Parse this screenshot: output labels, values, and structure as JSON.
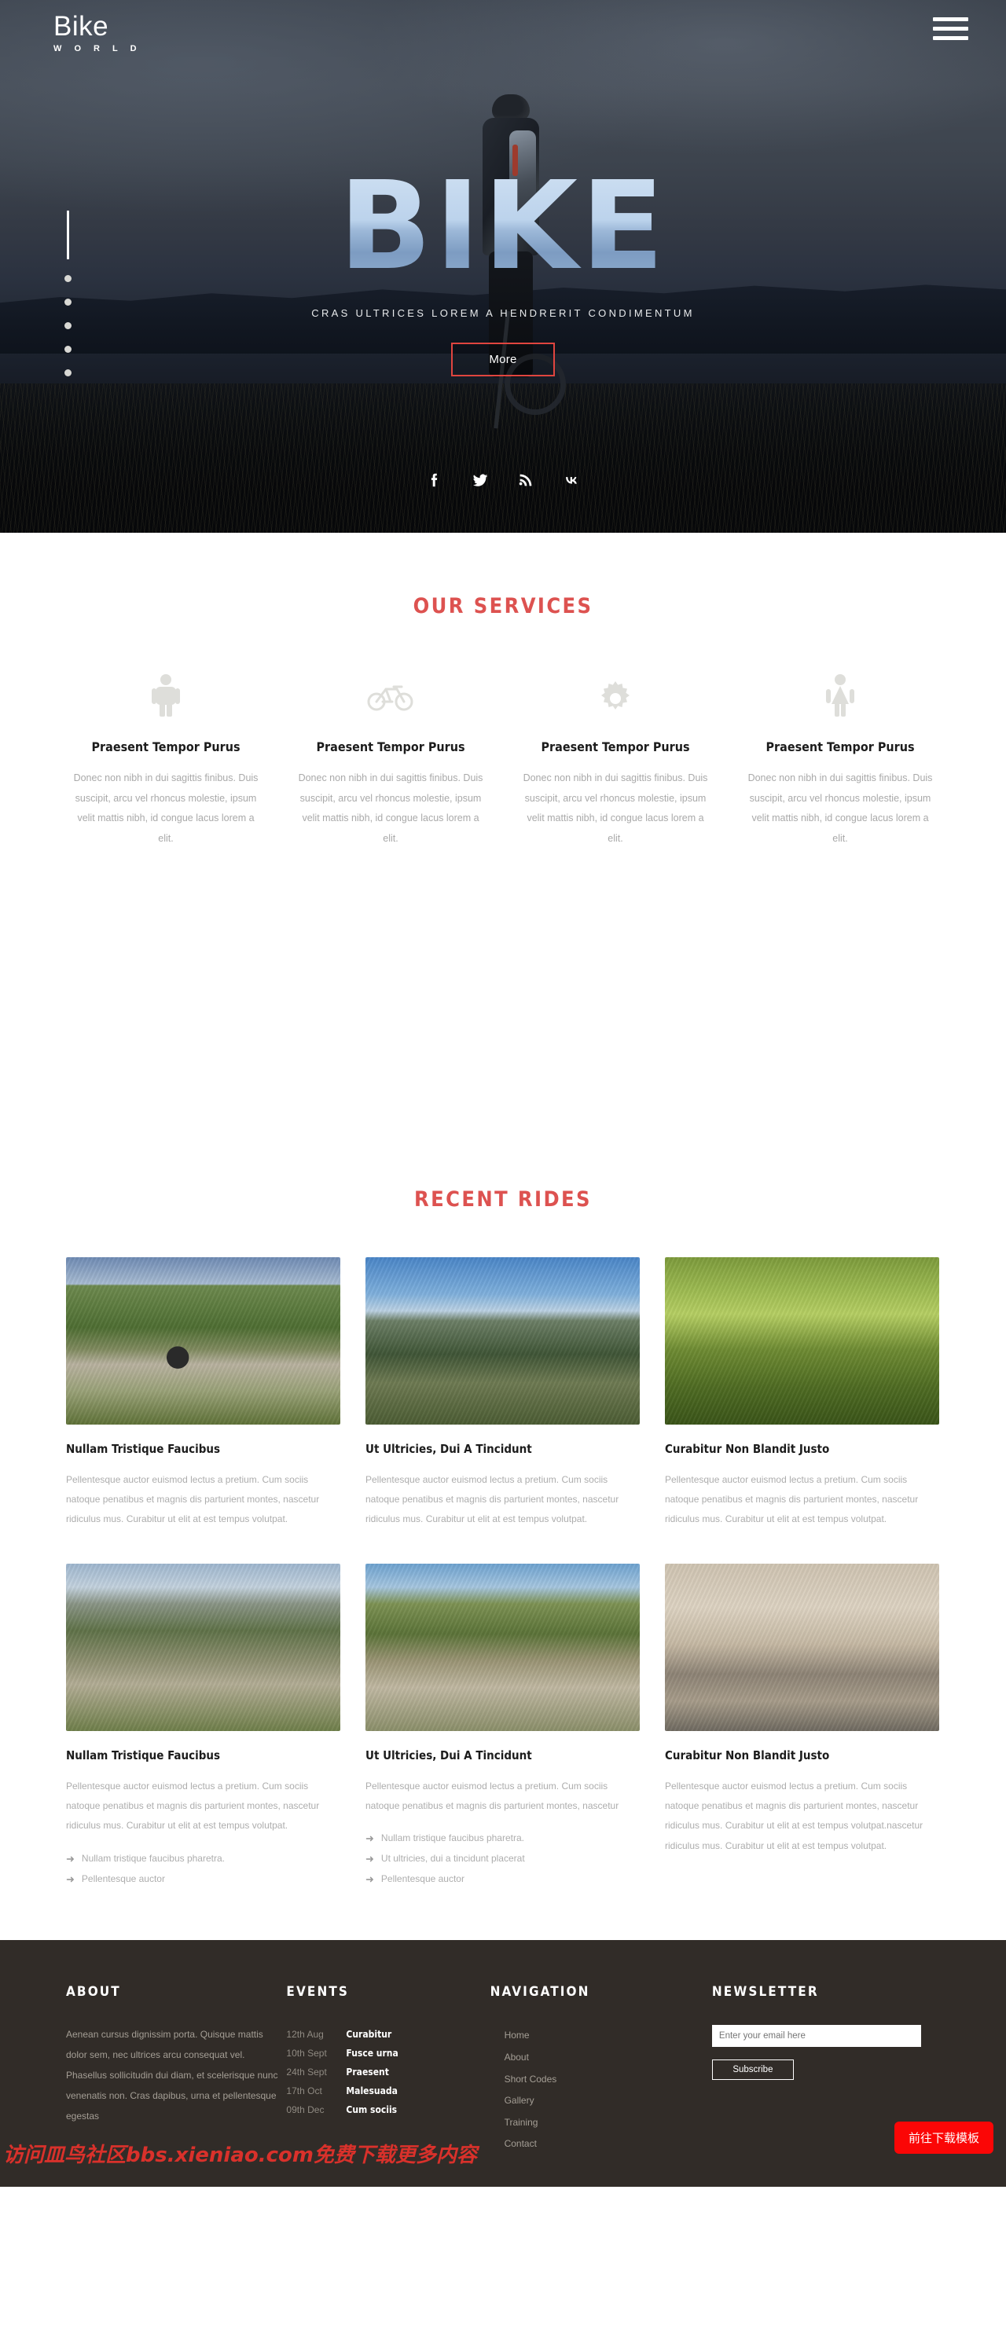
{
  "header": {
    "brand_name": "Bike",
    "brand_sub": "W O R L D",
    "menu_icon": "hamburger-menu-icon"
  },
  "hero": {
    "headline": "BIKE",
    "tagline": "CRAS ULTRICES LOREM A HENDRERIT CONDIMENTUM",
    "cta_label": "More",
    "cta_border_color": "#e0453f",
    "socials": [
      "facebook-icon",
      "twitter-icon",
      "rss-icon",
      "vk-icon"
    ],
    "dot_count": 5
  },
  "services": {
    "title": "OUR SERVICES",
    "title_color": "#dd5250",
    "items": [
      {
        "icon": "male-figure-icon",
        "title": "Praesent Tempor Purus",
        "text": "Donec non nibh in dui sagittis finibus. Duis suscipit, arcu vel rhoncus molestie, ipsum velit mattis nibh, id congue lacus lorem a elit."
      },
      {
        "icon": "bicycle-icon",
        "title": "Praesent Tempor Purus",
        "text": "Donec non nibh in dui sagittis finibus. Duis suscipit, arcu vel rhoncus molestie, ipsum velit mattis nibh, id congue lacus lorem a elit."
      },
      {
        "icon": "gear-icon",
        "title": "Praesent Tempor Purus",
        "text": "Donec non nibh in dui sagittis finibus. Duis suscipit, arcu vel rhoncus molestie, ipsum velit mattis nibh, id congue lacus lorem a elit."
      },
      {
        "icon": "female-figure-icon",
        "title": "Praesent Tempor Purus",
        "text": "Donec non nibh in dui sagittis finibus. Duis suscipit, arcu vel rhoncus molestie, ipsum velit mattis nibh, id congue lacus lorem a elit."
      }
    ]
  },
  "rides": {
    "title": "RECENT RIDES",
    "title_color": "#dd5250",
    "row1": [
      {
        "image": "cyclist-on-gravel-mountain-road",
        "title": "Nullam Tristique Faucibus",
        "text": "Pellentesque auctor euismod lectus a pretium. Cum sociis natoque penatibus et magnis dis parturient montes, nascetur ridiculus mus. Curabitur ut elit at est tempus volutpat.",
        "links": []
      },
      {
        "image": "cyclist-standing-on-ridge",
        "title": "Ut Ultricies, Dui A Tincidunt",
        "text": "Pellentesque auctor euismod lectus a pretium. Cum sociis natoque penatibus et magnis dis parturient montes, nascetur ridiculus mus. Curabitur ut elit at est tempus volutpat.",
        "links": []
      },
      {
        "image": "cyclists-on-green-grass-lane",
        "title": "Curabitur Non Blandit Justo",
        "text": "Pellentesque auctor euismod lectus a pretium. Cum sociis natoque penatibus et magnis dis parturient montes, nascetur ridiculus mus. Curabitur ut elit at est tempus volutpat.",
        "links": []
      }
    ],
    "row2": [
      {
        "image": "cyclists-on-alpine-river-trail",
        "title": "Nullam Tristique Faucibus",
        "text": "Pellentesque auctor euismod lectus a pretium. Cum sociis natoque penatibus et magnis dis parturient montes, nascetur ridiculus mus. Curabitur ut elit at est tempus volutpat.",
        "links": [
          "Nullam tristique faucibus pharetra.",
          "Pellentesque auctor"
        ]
      },
      {
        "image": "group-of-cyclists-on-road",
        "title": "Ut Ultricies, Dui A Tincidunt",
        "text": "Pellentesque auctor euismod lectus a pretium. Cum sociis natoque penatibus et magnis dis parturient montes, nascetur",
        "links": [
          "Nullam tristique faucibus pharetra.",
          "Ut ultricies, dui a tincidunt placerat",
          "Pellentesque auctor"
        ]
      },
      {
        "image": "cyclists-in-old-town-street",
        "title": "Curabitur Non Blandit Justo",
        "text": "Pellentesque auctor euismod lectus a pretium. Cum sociis natoque penatibus et magnis dis parturient montes, nascetur ridiculus mus. Curabitur ut elit at est tempus volutpat.nascetur ridiculus mus. Curabitur ut elit at est tempus volutpat.",
        "links": []
      }
    ]
  },
  "footer": {
    "background": "#312c28",
    "about": {
      "title": "ABOUT",
      "text": "Aenean cursus dignissim porta. Quisque mattis dolor sem, nec ultrices arcu consequat vel. Phasellus sollicitudin dui diam, et scelerisque nunc venenatis non. Cras dapibus, urna et pellentesque egestas"
    },
    "events": {
      "title": "EVENTS",
      "items": [
        {
          "date": "12th Aug",
          "name": "Curabitur"
        },
        {
          "date": "10th Sept",
          "name": "Fusce urna"
        },
        {
          "date": "24th Sept",
          "name": "Praesent"
        },
        {
          "date": "17th Oct",
          "name": "Malesuada"
        },
        {
          "date": "09th Dec",
          "name": "Cum sociis"
        }
      ]
    },
    "navigation": {
      "title": "NAVIGATION",
      "items": [
        "Home",
        "About",
        "Short Codes",
        "Gallery",
        "Training",
        "Contact"
      ]
    },
    "newsletter": {
      "title": "NEWSLETTER",
      "placeholder": "Enter your email here",
      "value": "",
      "button_label": "Subscribe"
    },
    "cta": {
      "label": "前往下载模板",
      "color": "#fb0606"
    },
    "watermark": "访问皿鸟社区bbs.xieniao.com免费下载更多内容"
  }
}
